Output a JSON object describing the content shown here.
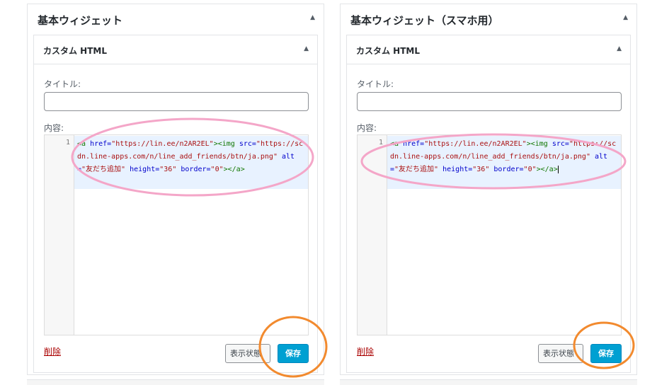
{
  "panels": [
    {
      "area_title": "基本ウィジェット",
      "widget_title": "カスタム HTML",
      "title_label": "タイトル:",
      "title_value": "",
      "content_label": "内容:",
      "line_number": "1",
      "code": {
        "open": "<a",
        "href_attr": "href=",
        "href_val": "\"https://lin.ee/n2AR2EL\"",
        "img_open": "><img",
        "src_attr": "src=",
        "src_val": "\"https://scdn.line-apps.com/n/line_add_friends/btn/ja.png\"",
        "alt_attr": "alt=",
        "alt_val": "\"友だち追加\"",
        "height_attr": "height=",
        "height_val": "\"36\"",
        "border_attr": "border=",
        "border_val": "\"0\"",
        "close": "></a>"
      },
      "delete_label": "削除",
      "display_label": "表示状態",
      "save_label": "保存"
    },
    {
      "area_title": "基本ウィジェット（スマホ用）",
      "widget_title": "カスタム HTML",
      "title_label": "タイトル:",
      "title_value": "",
      "content_label": "内容:",
      "line_number": "1",
      "code": {
        "open": "<a",
        "href_attr": "href=",
        "href_val": "\"https://lin.ee/n2AR2EL\"",
        "img_open": "><img",
        "src_attr": "src=",
        "src_val": "\"https://scdn.line-apps.com/n/line_add_friends/btn/ja.png\"",
        "alt_attr": "alt=",
        "alt_val": "\"友だち追加\"",
        "height_attr": "height=",
        "height_val": "\"36\"",
        "border_attr": "border=",
        "border_val": "\"0\"",
        "close": "></a>"
      },
      "delete_label": "削除",
      "display_label": "表示状態",
      "save_label": "保存"
    }
  ],
  "colors": {
    "primary_button": "#00a0d2",
    "delete_link": "#aa0000",
    "pink_annotation": "#f4a6c8",
    "orange_annotation": "#f28a2e",
    "code_highlight": "#e8f2ff"
  }
}
